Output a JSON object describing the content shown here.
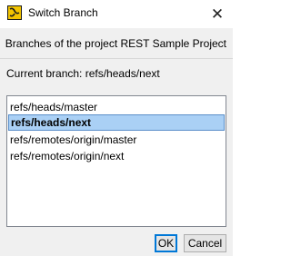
{
  "window": {
    "title": "Switch Branch",
    "icon": "app-icon"
  },
  "header": {
    "text": "Branches of the project REST Sample Project"
  },
  "current_branch": {
    "label": "Current branch: refs/heads/next"
  },
  "branches": [
    {
      "label": "refs/heads/master",
      "selected": false
    },
    {
      "label": "refs/heads/next",
      "selected": true
    },
    {
      "label": "refs/remotes/origin/master",
      "selected": false
    },
    {
      "label": "refs/remotes/origin/next",
      "selected": false
    }
  ],
  "buttons": {
    "ok_label": "OK",
    "cancel_label": "Cancel"
  },
  "colors": {
    "selection": "#aad0f5",
    "selection_border": "#5b8fc9",
    "icon_bg": "#f2c400",
    "dialog_bg": "#f0f0f0"
  }
}
